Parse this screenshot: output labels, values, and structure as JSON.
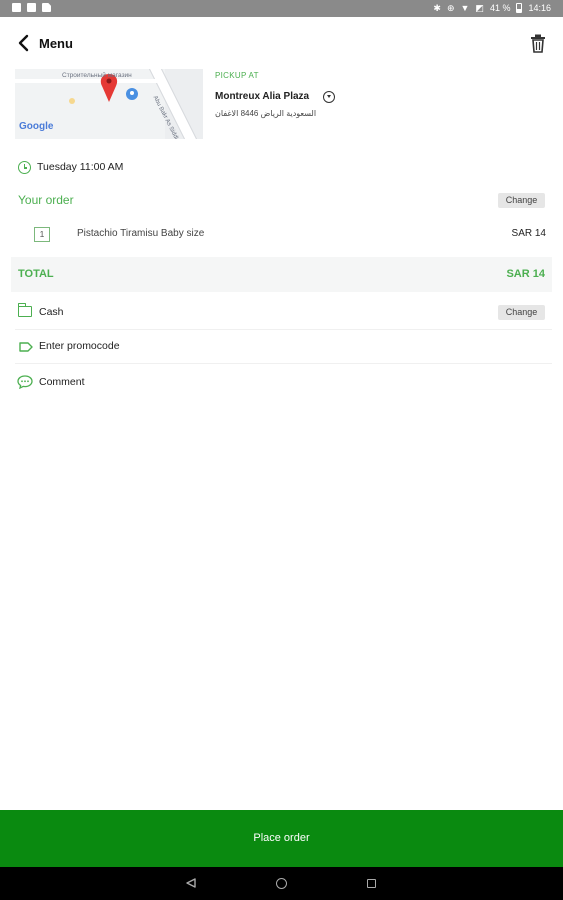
{
  "status_bar": {
    "battery_text": "41 %",
    "time": "14:16",
    "icons": [
      "notification-icon",
      "photo-icon",
      "image-icon",
      "bluetooth-icon",
      "data-saver-icon",
      "wifi-icon",
      "no-sim-icon",
      "battery-icon"
    ]
  },
  "header": {
    "back_icon": "chevron-left-icon",
    "title": "Menu",
    "delete_icon": "trash-icon"
  },
  "pickup": {
    "label": "PICKUP AT",
    "name": "Montreux Alia Plaza",
    "address": "السعودية الرياض 8446 الاغفان",
    "map": {
      "street_label": "Строительный магазин",
      "road_label": "Abu Bakr As Siddiq Rd",
      "logo": "Google"
    }
  },
  "order": {
    "time": "Tuesday 11:00 AM",
    "section_title": "Your order",
    "change_label": "Change",
    "items": [
      {
        "qty": "1",
        "name": "Pistachio Tiramisu Baby size",
        "price": "SAR 14"
      }
    ],
    "total_label": "TOTAL",
    "total_value": "SAR 14"
  },
  "payment": {
    "method": "Cash",
    "change_label": "Change"
  },
  "promo": {
    "label": "Enter promocode"
  },
  "comment": {
    "label": "Comment"
  },
  "place_order": {
    "label": "Place order"
  },
  "colors": {
    "accent_green": "#4caf50",
    "button_green": "#0a8a10",
    "status_bar_gray": "#8a8a8a"
  }
}
